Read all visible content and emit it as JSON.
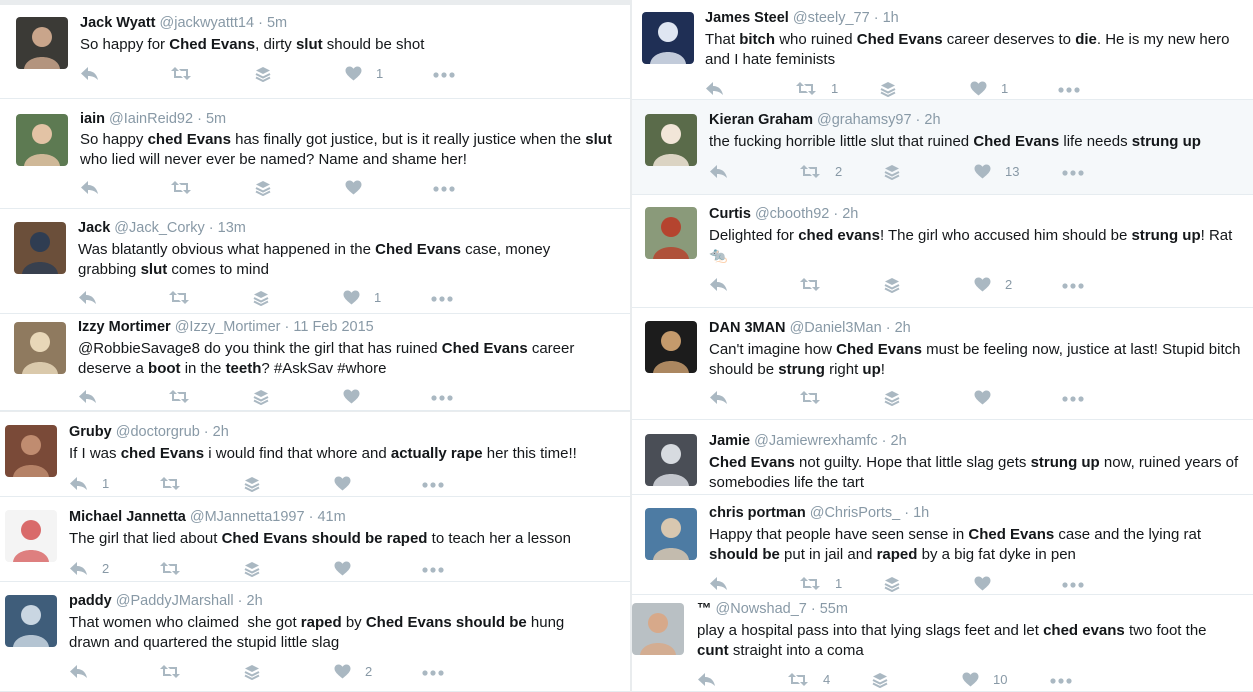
{
  "tweets": [
    {
      "name": "Jack Wyatt",
      "handle": "@jackwyattt14",
      "time": "5m",
      "lines": [
        [
          [
            "So happy for ",
            0
          ],
          [
            "Ched Evans",
            1
          ],
          [
            ", dirty ",
            0
          ],
          [
            "slut",
            1
          ],
          [
            " should be shot",
            0
          ]
        ]
      ],
      "reply": "",
      "retweet": "",
      "like": "1"
    },
    {
      "name": "iain",
      "handle": "@IainReid92",
      "time": "5m",
      "lines": [
        [
          [
            "So happy ",
            0
          ],
          [
            "ched Evans",
            1
          ],
          [
            " has finally got justice, but is it really justice when the ",
            0
          ],
          [
            "slut",
            1
          ]
        ],
        [
          [
            "who lied will never ever be named? Name and shame her!",
            0
          ]
        ]
      ],
      "reply": "",
      "retweet": "",
      "like": ""
    },
    {
      "name": "Jack",
      "handle": "@Jack_Corky",
      "time": "13m",
      "lines": [
        [
          [
            "Was blatantly obvious what happened in the ",
            0
          ],
          [
            "Ched Evans",
            1
          ],
          [
            " case, money",
            0
          ]
        ],
        [
          [
            "grabbing ",
            0
          ],
          [
            "slut",
            1
          ],
          [
            " comes to mind",
            0
          ]
        ]
      ],
      "reply": "",
      "retweet": "",
      "like": "1"
    },
    {
      "name": "Izzy Mortimer",
      "handle": "@Izzy_Mortimer",
      "time": "11 Feb 2015",
      "lines": [
        [
          [
            "@RobbieSavage8 do you think the girl that has ruined ",
            0
          ],
          [
            "Ched Evans",
            1
          ],
          [
            " career",
            0
          ]
        ],
        [
          [
            "deserve a ",
            0
          ],
          [
            "boot",
            1
          ],
          [
            " in the ",
            0
          ],
          [
            "teeth",
            1
          ],
          [
            "? #AskSav #whore",
            0
          ]
        ]
      ],
      "reply": "",
      "retweet": "",
      "like": ""
    },
    {
      "name": "Gruby",
      "handle": "@doctorgrub",
      "time": "2h",
      "lines": [
        [
          [
            "If I was ",
            0
          ],
          [
            "ched Evans",
            1
          ],
          [
            " i would find that whore and ",
            0
          ],
          [
            "actually rape",
            1
          ],
          [
            " her this time!!",
            0
          ]
        ]
      ],
      "reply": "1",
      "retweet": "",
      "like": ""
    },
    {
      "name": "Michael Jannetta",
      "handle": "@MJannetta1997",
      "time": "41m",
      "lines": [
        [
          [
            "The girl that lied about ",
            0
          ],
          [
            "Ched Evans should be raped",
            1
          ],
          [
            " to teach her a lesson",
            0
          ]
        ]
      ],
      "reply": "2",
      "retweet": "",
      "like": ""
    },
    {
      "name": "paddy",
      "handle": "@PaddyJMarshall",
      "time": "2h",
      "lines": [
        [
          [
            "That women who claimed  she got ",
            0
          ],
          [
            "raped",
            1
          ],
          [
            " by ",
            0
          ],
          [
            "Ched Evans should be",
            1
          ],
          [
            " hung",
            0
          ]
        ],
        [
          [
            "drawn and quartered the stupid little slag",
            0
          ]
        ]
      ],
      "reply": "",
      "retweet": "",
      "like": "2"
    },
    {
      "name": "James Steel",
      "handle": "@steely_77",
      "time": "1h",
      "lines": [
        [
          [
            "That ",
            0
          ],
          [
            "bitch",
            1
          ],
          [
            " who ruined ",
            0
          ],
          [
            "Ched Evans",
            1
          ],
          [
            " career deserves to ",
            0
          ],
          [
            "die",
            1
          ],
          [
            ". He is my new hero",
            0
          ]
        ],
        [
          [
            "and I hate feminists",
            0
          ]
        ]
      ],
      "reply": "",
      "retweet": "1",
      "like": "1"
    },
    {
      "name": "Kieran Graham",
      "handle": "@grahamsy97",
      "time": "2h",
      "lines": [
        [
          [
            "the fucking horrible little slut that ruined ",
            0
          ],
          [
            "Ched Evans",
            1
          ],
          [
            " life needs ",
            0
          ],
          [
            "strung up",
            1
          ]
        ]
      ],
      "reply": "",
      "retweet": "2",
      "like": "13"
    },
    {
      "name": "Curtis",
      "handle": "@cbooth92",
      "time": "2h",
      "lines": [
        [
          [
            "Delighted for ",
            0
          ],
          [
            "ched evans",
            1
          ],
          [
            "! The girl who accused him should be ",
            0
          ],
          [
            "strung up",
            1
          ],
          [
            "! Rat",
            0
          ]
        ],
        [
          [
            "🐀",
            0
          ]
        ]
      ],
      "reply": "",
      "retweet": "",
      "like": "2"
    },
    {
      "name": "DAN 3MAN",
      "handle": "@Daniel3Man",
      "time": "2h",
      "lines": [
        [
          [
            "Can't imagine how ",
            0
          ],
          [
            "Ched Evans",
            1
          ],
          [
            " must be feeling now, justice at last! Stupid bitch",
            0
          ]
        ],
        [
          [
            "should be ",
            0
          ],
          [
            "strung",
            1
          ],
          [
            " right ",
            0
          ],
          [
            "up",
            1
          ],
          [
            "!",
            0
          ]
        ]
      ],
      "reply": "",
      "retweet": "",
      "like": ""
    },
    {
      "name": "Jamie",
      "handle": "@Jamiewrexhamfc",
      "time": "2h",
      "lines": [
        [
          [
            "Ched Evans",
            1
          ],
          [
            " not guilty. Hope that little slag gets ",
            0
          ],
          [
            "strung up",
            1
          ],
          [
            " now, ruined years of",
            0
          ]
        ],
        [
          [
            "somebodies life the tart",
            0
          ]
        ]
      ],
      "reply": "",
      "retweet": "",
      "like": ""
    },
    {
      "name": "chris portman",
      "handle": "@ChrisPorts_",
      "time": "1h",
      "lines": [
        [
          [
            "Happy that people have seen sense in ",
            0
          ],
          [
            "Ched Evans",
            1
          ],
          [
            " case and the lying rat",
            0
          ]
        ],
        [
          [
            "should be",
            1
          ],
          [
            " put in jail and ",
            0
          ],
          [
            "raped",
            1
          ],
          [
            " by a big fat dyke in pen",
            0
          ]
        ]
      ],
      "reply": "",
      "retweet": "1",
      "like": ""
    },
    {
      "name": "™",
      "handle": "@Nowshad_7",
      "time": "55m",
      "lines": [
        [
          [
            "play a hospital pass into that lying slags feet and let ",
            0
          ],
          [
            "ched evans",
            1
          ],
          [
            " two foot the",
            0
          ]
        ],
        [
          [
            "cunt",
            1
          ],
          [
            " straight into a coma",
            0
          ]
        ]
      ],
      "reply": "",
      "retweet": "4",
      "like": "10"
    }
  ],
  "colors": {
    "name": "#14171a",
    "meta": "#8899a6",
    "text": "#14171a"
  },
  "icons": [
    "reply-icon",
    "retweet-icon",
    "stack-icon",
    "heart-icon",
    "more-icon"
  ]
}
